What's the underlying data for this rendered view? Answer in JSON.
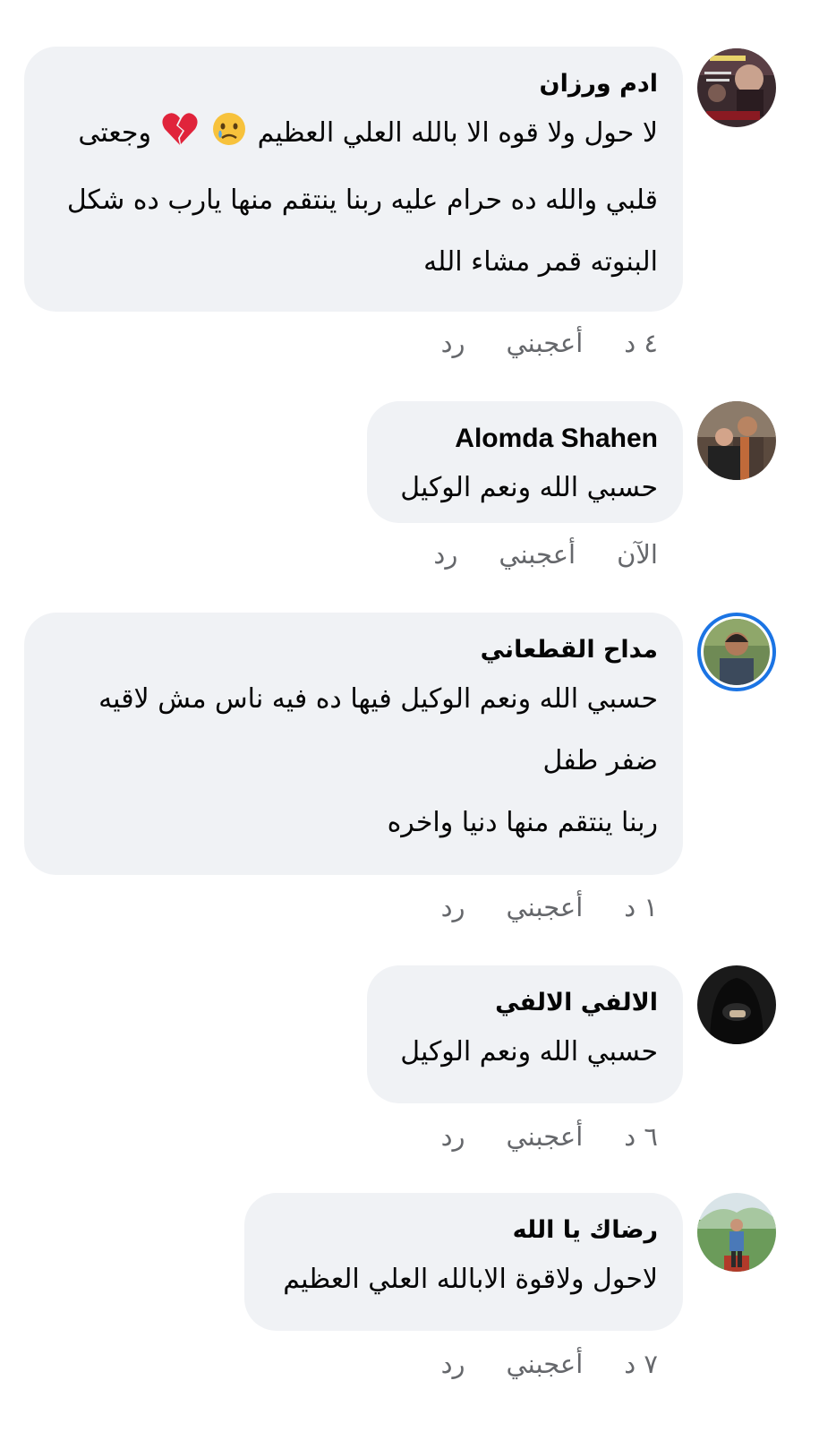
{
  "comments": [
    {
      "name": "ادم ورزان",
      "lines": [
        "لا حول ولا قوه الا بالله العلي العظيم",
        "قلبي والله ده حرام عليه ربنا ينتقم منها يارب ده شكل",
        "البنوته قمر مشاء الله"
      ],
      "line1_tail": "وجعتى",
      "emojis": [
        "sad-tear-face-icon",
        "broken-heart-icon"
      ],
      "time": "٤ د",
      "like": "أعجبني",
      "reply": "رد"
    },
    {
      "name": "Alomda Shahen",
      "lines": [
        "حسبي الله ونعم الوكيل"
      ],
      "time": "الآن",
      "like": "أعجبني",
      "reply": "رد"
    },
    {
      "name": "مداح القطعاني",
      "lines": [
        "حسبي الله ونعم الوكيل فيها ده فيه ناس مش لاقيه",
        "ضفر طفل",
        "ربنا ينتقم منها دنيا واخره"
      ],
      "time": "١ د",
      "like": "أعجبني",
      "reply": "رد"
    },
    {
      "name": "الالفي الالفي",
      "lines": [
        "حسبي الله ونعم الوكيل"
      ],
      "time": "٦ د",
      "like": "أعجبني",
      "reply": "رد"
    },
    {
      "name": "رضاك يا الله",
      "lines": [
        "لاحول ولاقوة الابالله العلي العظيم"
      ],
      "time": "٧ د",
      "like": "أعجبني",
      "reply": "رد"
    }
  ],
  "colors": {
    "bubble": "#f0f2f5",
    "meta_text": "#65676b",
    "story_ring": "#1b74e4"
  }
}
